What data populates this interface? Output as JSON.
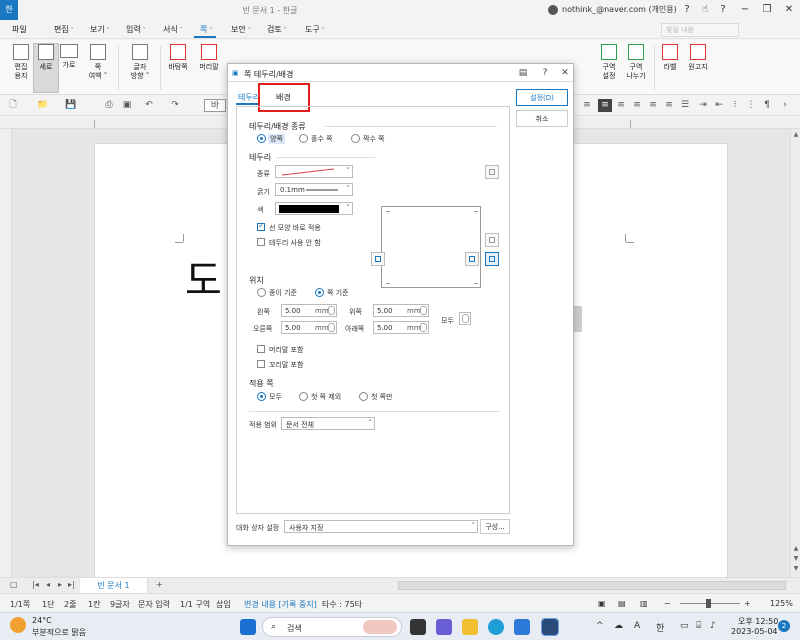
{
  "app": {
    "title": "빈 문서 1 - 한글",
    "account": "nothink_@naver.com (개인용)",
    "icon_text": "한"
  },
  "menu": {
    "items": [
      "파일",
      "편집",
      "보기",
      "입력",
      "서식",
      "쪽",
      "보안",
      "검토",
      "도구"
    ],
    "active_index": 5,
    "search_placeholder": "찾을 내용"
  },
  "ribbon": {
    "items": [
      {
        "label": "편집\n용지",
        "icon": "page-setup-icon"
      },
      {
        "label": "세로",
        "icon": "portrait-icon"
      },
      {
        "label": "가로",
        "icon": "landscape-icon"
      },
      {
        "label": "쪽\n여백 ˅",
        "icon": "margin-icon"
      },
      {
        "label": "글자\n방향 ˅",
        "icon": "text-direction-icon"
      },
      {
        "label": "바탕쪽",
        "icon": "master-page-icon"
      },
      {
        "label": "머리말",
        "icon": "header-icon"
      },
      {
        "label": "구역\n설정",
        "icon": "section-settings-icon"
      },
      {
        "label": "구역\n나누기",
        "icon": "section-break-icon"
      },
      {
        "label": "라벨",
        "icon": "label-icon"
      },
      {
        "label": "원고지",
        "icon": "manuscript-icon"
      }
    ]
  },
  "toolbar2": {
    "style_label": "바"
  },
  "document": {
    "text": "도"
  },
  "watermark": {
    "text": "nothink"
  },
  "dialog": {
    "title": "쪽 테두리/배경",
    "tabs": [
      "테두리",
      "배경"
    ],
    "active_tab": 0,
    "buttons": {
      "ok": "설정(D)",
      "cancel": "취소"
    },
    "border_type_section": {
      "title": "테두리/배경 종류",
      "options": [
        "양쪽",
        "홀수 쪽",
        "짝수 쪽"
      ],
      "selected": 0
    },
    "border_section": {
      "title": "테두리",
      "type_label": "종류",
      "thickness_label": "굵기",
      "thickness_value": "0.1mm",
      "color_label": "색",
      "color_value": "#000000",
      "check_apply_shape": "선 모양 바로 적용",
      "check_apply_shape_checked": true,
      "check_no_border": "테두리 사용 안 함",
      "check_no_border_checked": false
    },
    "position_section": {
      "title": "위치",
      "options": [
        "종이 기준",
        "쪽 기준"
      ],
      "selected": 1,
      "left_label": "왼쪽",
      "left_value": "5.00",
      "top_label": "위쪽",
      "top_value": "5.00",
      "right_label": "오른쪽",
      "right_value": "5.00",
      "bottom_label": "아래쪽",
      "bottom_value": "5.00",
      "unit": "mm",
      "all_label": "모두",
      "check_header": "머리말 포함",
      "check_footer": "꼬리말 포함"
    },
    "apply_section": {
      "title": "적용 쪽",
      "options": [
        "모두",
        "첫 쪽 제외",
        "첫 쪽만"
      ],
      "selected": 0,
      "scope_label": "적용 범위",
      "scope_value": "문서 전체"
    },
    "footer": {
      "label": "대화 상자 설정",
      "value": "사용자 지정",
      "button": "구성..."
    }
  },
  "tabbar": {
    "doc_tab": "빈 문서 1",
    "add": "+"
  },
  "statusbar": {
    "page": "1/1쪽",
    "section": "1단",
    "line": "2줄",
    "col": "1칸",
    "chars": "9글자",
    "mode": "문자 입력",
    "section_no": "1/1 구역",
    "insert": "삽입",
    "track": "변경 내용 [기록 중지]",
    "count": "타수 : 75타",
    "zoom": "125%"
  },
  "taskbar": {
    "weather_temp": "24°C",
    "weather_desc": "부분적으로 맑음",
    "search_label": "검색",
    "ime_mode": "A",
    "ime_lang": "한",
    "time": "오후 12:50",
    "date": "2023-05-04",
    "notifications": "2"
  }
}
